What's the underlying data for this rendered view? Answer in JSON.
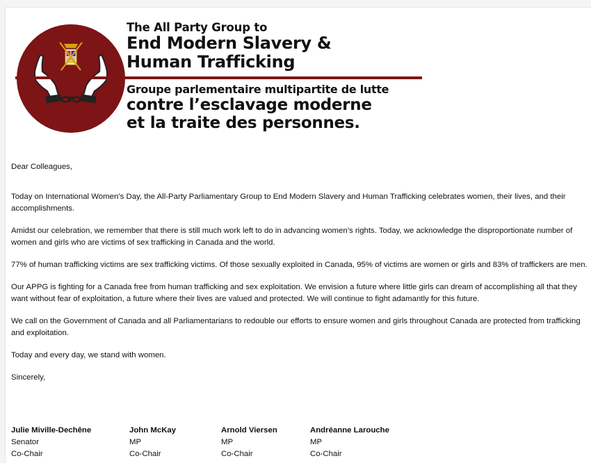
{
  "header": {
    "en_line1": "The All Party Group to",
    "en_line2": "End Modern Slavery &",
    "en_line3": "Human Trafficking",
    "fr_line1": "Groupe parlementaire multipartite de lutte",
    "fr_line2": "contre l’esclavage moderne",
    "fr_line3": "et la traite des personnes.",
    "logo_color": "#7d1416"
  },
  "letter": {
    "greeting": "Dear Colleagues,",
    "paragraphs": [
      "Today on International Women’s Day, the All-Party Parliamentary Group to End Modern Slavery and Human Trafficking celebrates women, their lives, and their accomplishments.",
      "Amidst our celebration, we remember that there is still much work left to do in advancing women’s rights. Today, we acknowledge the disproportionate number of women and girls who are victims of sex trafficking in Canada and the world.",
      "77% of human trafficking victims are sex trafficking victims. Of those sexually exploited in Canada, 95% of victims are women or girls and 83% of traffickers are men.",
      "Our APPG is fighting for a Canada free from human trafficking and sex exploitation. We envision a future where little girls can dream of accomplishing all that they want without fear of exploitation, a future where their lives are valued and protected. We will continue to fight adamantly for this future.",
      "We call on the Government of Canada and all Parliamentarians to redouble our efforts to ensure women and girls throughout Canada are protected from trafficking and exploitation.",
      "Today and every day, we stand with women."
    ],
    "closing": "Sincerely,"
  },
  "signatories": [
    {
      "name": "Julie Miville-Dechêne",
      "role": "Senator",
      "title": "Co-Chair"
    },
    {
      "name": "John McKay",
      "role": "MP",
      "title": "Co-Chair"
    },
    {
      "name": "Arnold Viersen",
      "role": "MP",
      "title": "Co-Chair"
    },
    {
      "name": "Andréanne Larouche",
      "role": "MP",
      "title": "Co-Chair"
    }
  ]
}
